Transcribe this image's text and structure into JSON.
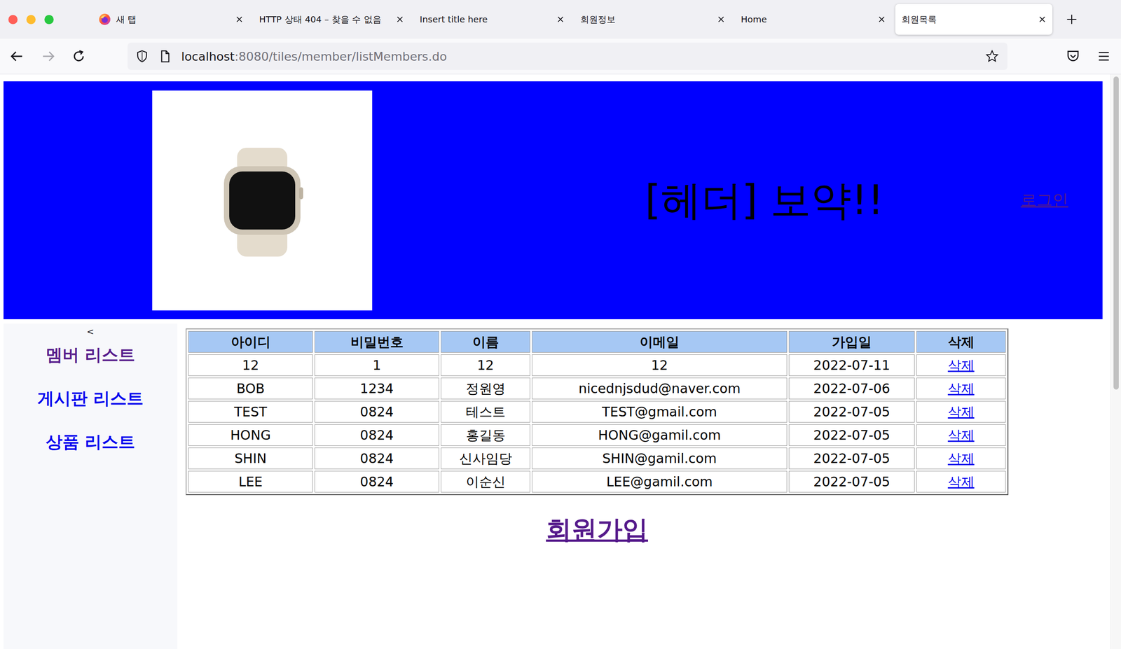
{
  "browser": {
    "tabs": [
      {
        "label": "새 탭",
        "selected": false,
        "favicon": true
      },
      {
        "label": "HTTP 상태 404 – 찾을 수 없음",
        "selected": false,
        "favicon": false
      },
      {
        "label": "Insert title here",
        "selected": false,
        "favicon": false
      },
      {
        "label": "회원정보",
        "selected": false,
        "favicon": false
      },
      {
        "label": "Home",
        "selected": false,
        "favicon": false
      },
      {
        "label": "회원목록",
        "selected": true,
        "favicon": false
      }
    ],
    "url": {
      "host": "localhost",
      "rest": ":8080/tiles/member/listMembers.do"
    }
  },
  "header": {
    "title": "[헤더] 보약!!",
    "login": {
      "label": "로그인",
      "visited": true
    }
  },
  "sidebar": {
    "toggle": "<",
    "items": [
      {
        "label": "멤버 리스트",
        "visited": true
      },
      {
        "label": "게시판 리스트",
        "visited": false
      },
      {
        "label": "상품 리스트",
        "visited": false
      }
    ]
  },
  "table": {
    "columns": [
      "아이디",
      "비밀번호",
      "이름",
      "이메일",
      "가입일",
      "삭제"
    ],
    "rows": [
      {
        "cells": [
          "12",
          "1",
          "12",
          "12",
          "2022-07-11"
        ],
        "action": "삭제"
      },
      {
        "cells": [
          "BOB",
          "1234",
          "정원영",
          "nicednjsdud@naver.com",
          "2022-07-06"
        ],
        "action": "삭제"
      },
      {
        "cells": [
          "TEST",
          "0824",
          "테스트",
          "TEST@gmail.com",
          "2022-07-05"
        ],
        "action": "삭제"
      },
      {
        "cells": [
          "HONG",
          "0824",
          "홍길동",
          "HONG@gamil.com",
          "2022-07-05"
        ],
        "action": "삭제"
      },
      {
        "cells": [
          "SHIN",
          "0824",
          "신사임당",
          "SHIN@gamil.com",
          "2022-07-05"
        ],
        "action": "삭제"
      },
      {
        "cells": [
          "LEE",
          "0824",
          "이순신",
          "LEE@gamil.com",
          "2022-07-05"
        ],
        "action": "삭제"
      }
    ]
  },
  "signup": {
    "label": "회원가입",
    "visited": true
  }
}
